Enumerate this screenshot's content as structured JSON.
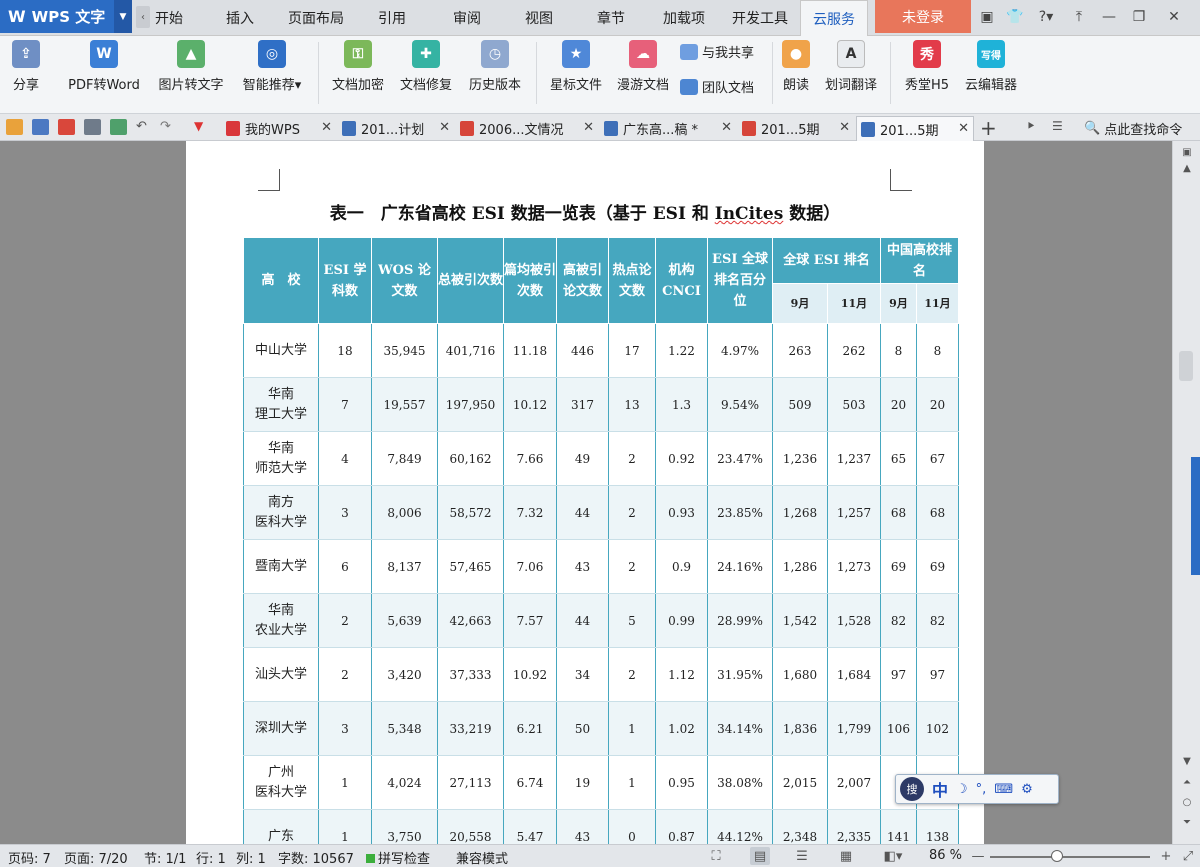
{
  "app": {
    "name": "WPS 文字",
    "logo": "W"
  },
  "menu": {
    "tabs": [
      "开始",
      "插入",
      "页面布局",
      "引用",
      "审阅",
      "视图",
      "章节",
      "加载项",
      "开发工具",
      "云服务"
    ],
    "active": "云服务",
    "login": "未登录"
  },
  "ribbon": {
    "share": "分享",
    "pdf_to_word": "PDF转Word",
    "image_to_text": "图片转文字",
    "smart_recommend": "智能推荐",
    "doc_encrypt": "文档加密",
    "doc_repair": "文档修复",
    "history": "历史版本",
    "star_files": "星标文件",
    "roam_docs": "漫游文档",
    "shared_with_me": "与我共享",
    "team_docs": "团队文档",
    "read_aloud": "朗读",
    "translate": "划词翻译",
    "xiutang": "秀堂H5",
    "cloud_editor": "云编辑器",
    "xiutang_icon": "秀",
    "editor_icon": "写得"
  },
  "doc_tabs": [
    {
      "label": "我的WPS",
      "kind": "wps"
    },
    {
      "label": "201...计划",
      "kind": "doc"
    },
    {
      "label": "2006...文情况",
      "kind": "pdf"
    },
    {
      "label": "广东高...稿 *",
      "kind": "doc"
    },
    {
      "label": "201...5期",
      "kind": "pdf"
    },
    {
      "label": "201...5期",
      "kind": "doc",
      "active": true
    }
  ],
  "command_search": "点此查找命令",
  "document": {
    "title_prefix": "表一　广东省高校 ESI 数据一览表（基于 ESI 和 ",
    "title_underlined": "InCites",
    "title_suffix": " 数据）",
    "headers": {
      "school": "高　校",
      "esi_subjects": "ESI 学科数",
      "wos_papers": "WOS 论文数",
      "total_citations": "总被引次数",
      "avg_citations": "篇均被引次数",
      "highly_cited": "高被引论文数",
      "hot_papers": "热点论文数",
      "cnci": "机构 CNCI",
      "esi_percentile": "ESI 全球排名百分位",
      "global_rank": "全球 ESI 排名",
      "china_rank": "中国高校排名",
      "sep": "9月",
      "nov": "11月"
    },
    "rows": [
      {
        "school": "中山大学",
        "subjects": "18",
        "wos": "35,945",
        "cites": "401,716",
        "avg": "11.18",
        "hc": "446",
        "hot": "17",
        "cnci": "1.22",
        "pct": "4.97%",
        "g_sep": "263",
        "g_nov": "262",
        "c_sep": "8",
        "c_nov": "8"
      },
      {
        "school": "华南\n理工大学",
        "subjects": "7",
        "wos": "19,557",
        "cites": "197,950",
        "avg": "10.12",
        "hc": "317",
        "hot": "13",
        "cnci": "1.3",
        "pct": "9.54%",
        "g_sep": "509",
        "g_nov": "503",
        "c_sep": "20",
        "c_nov": "20"
      },
      {
        "school": "华南\n师范大学",
        "subjects": "4",
        "wos": "7,849",
        "cites": "60,162",
        "avg": "7.66",
        "hc": "49",
        "hot": "2",
        "cnci": "0.92",
        "pct": "23.47%",
        "g_sep": "1,236",
        "g_nov": "1,237",
        "c_sep": "65",
        "c_nov": "67"
      },
      {
        "school": "南方\n医科大学",
        "subjects": "3",
        "wos": "8,006",
        "cites": "58,572",
        "avg": "7.32",
        "hc": "44",
        "hot": "2",
        "cnci": "0.93",
        "pct": "23.85%",
        "g_sep": "1,268",
        "g_nov": "1,257",
        "c_sep": "68",
        "c_nov": "68"
      },
      {
        "school": "暨南大学",
        "subjects": "6",
        "wos": "8,137",
        "cites": "57,465",
        "avg": "7.06",
        "hc": "43",
        "hot": "2",
        "cnci": "0.9",
        "pct": "24.16%",
        "g_sep": "1,286",
        "g_nov": "1,273",
        "c_sep": "69",
        "c_nov": "69"
      },
      {
        "school": "华南\n农业大学",
        "subjects": "2",
        "wos": "5,639",
        "cites": "42,663",
        "avg": "7.57",
        "hc": "44",
        "hot": "5",
        "cnci": "0.99",
        "pct": "28.99%",
        "g_sep": "1,542",
        "g_nov": "1,528",
        "c_sep": "82",
        "c_nov": "82"
      },
      {
        "school": "汕头大学",
        "subjects": "2",
        "wos": "3,420",
        "cites": "37,333",
        "avg": "10.92",
        "hc": "34",
        "hot": "2",
        "cnci": "1.12",
        "pct": "31.95%",
        "g_sep": "1,680",
        "g_nov": "1,684",
        "c_sep": "97",
        "c_nov": "97"
      },
      {
        "school": "深圳大学",
        "subjects": "3",
        "wos": "5,348",
        "cites": "33,219",
        "avg": "6.21",
        "hc": "50",
        "hot": "1",
        "cnci": "1.02",
        "pct": "34.14%",
        "g_sep": "1,836",
        "g_nov": "1,799",
        "c_sep": "106",
        "c_nov": "102"
      },
      {
        "school": "广州\n医科大学",
        "subjects": "1",
        "wos": "4,024",
        "cites": "27,113",
        "avg": "6.74",
        "hc": "19",
        "hot": "1",
        "cnci": "0.95",
        "pct": "38.08%",
        "g_sep": "2,015",
        "g_nov": "2,007",
        "c_sep": "",
        "c_nov": ""
      },
      {
        "school": "广东",
        "subjects": "1",
        "wos": "3,750",
        "cites": "20,558",
        "avg": "5.47",
        "hc": "43",
        "hot": "0",
        "cnci": "0.87",
        "pct": "44.12%",
        "g_sep": "2,348",
        "g_nov": "2,335",
        "c_sep": "141",
        "c_nov": "138"
      }
    ]
  },
  "ime": {
    "logo": "搜",
    "lang": "中"
  },
  "status": {
    "page_no": "页码: 7",
    "pages": "页面: 7/20",
    "section": "节: 1/1",
    "line": "行: 1",
    "col": "列: 1",
    "words": "字数: 10567",
    "spell": "拼写检查",
    "compat": "兼容模式",
    "zoom": "86 %",
    "zoom_level": 0.42
  },
  "colors": {
    "accent": "#2b6cc4",
    "table_header": "#46a7bf",
    "login": "#e8765b"
  }
}
